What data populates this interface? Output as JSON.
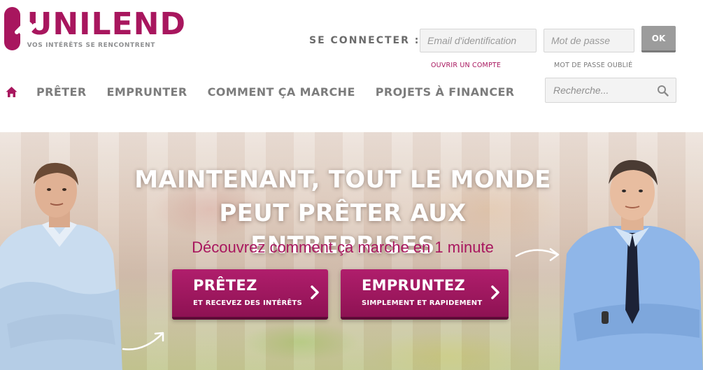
{
  "brand": {
    "name": "UNILEND",
    "tagline": "VOS INTÉRÊTS SE RENCONTRENT",
    "color": "#a8165e"
  },
  "login": {
    "label": "SE CONNECTER :",
    "email_placeholder": "Email d'identification",
    "password_placeholder": "Mot de passe",
    "submit_label": "OK",
    "open_account": "OUVRIR UN COMPTE",
    "forgot_password": "MOT DE PASSE OUBLIÉ"
  },
  "nav": {
    "home_icon": "home-icon",
    "items": [
      {
        "label": "PRÊTER"
      },
      {
        "label": "EMPRUNTER"
      },
      {
        "label": "COMMENT ÇA MARCHE"
      },
      {
        "label": "PROJETS À FINANCER"
      }
    ],
    "search_placeholder": "Recherche..."
  },
  "hero": {
    "title_line1": "MAINTENANT, TOUT LE MONDE",
    "title_line2": "PEUT PRÊTER AUX ENTREPRISES",
    "subtitle": "Découvrez comment ça marche en 1 minute",
    "cta_lend": {
      "title": "PRÊTEZ",
      "subtitle": "ET RECEVEZ DES INTÉRÊTS"
    },
    "cta_borrow": {
      "title": "EMPRUNTEZ",
      "subtitle": "SIMPLEMENT ET RAPIDEMENT"
    }
  }
}
